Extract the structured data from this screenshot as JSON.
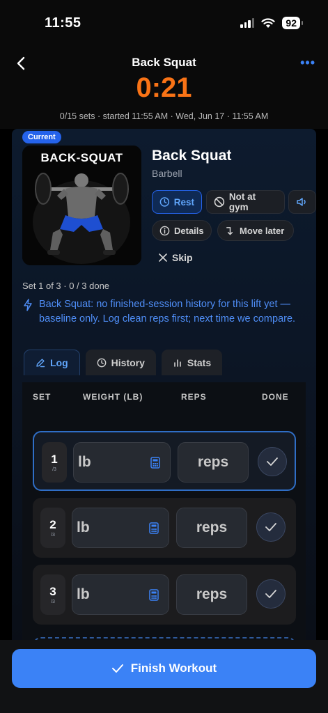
{
  "status": {
    "time": "11:55",
    "battery": "92"
  },
  "nav": {
    "title": "Back Squat",
    "more_icon": "ellipsis-icon"
  },
  "workout": {
    "timer": "0:21",
    "meta": "0/15 sets · started 11:55 AM · Wed, Jun 17 · 11:55 AM"
  },
  "exercise": {
    "badge": "Current",
    "image_title": "BACK-SQUAT",
    "name": "Back Squat",
    "equipment": "Barbell",
    "actions": {
      "rest": "Rest",
      "not_at_gym": "Not at gym",
      "details": "Details",
      "move_later": "Move later",
      "skip": "Skip"
    },
    "set_progress": "Set 1 of 3 · 0 / 3 done",
    "insight": "Back Squat: no finished-session history for this lift yet — baseline only. Log clean reps first; next time we compare."
  },
  "tabs": [
    {
      "label": "Log",
      "icon": "pencil-icon",
      "active": true
    },
    {
      "label": "History",
      "icon": "clock-icon",
      "active": false
    },
    {
      "label": "Stats",
      "icon": "bar-chart-icon",
      "active": false
    }
  ],
  "log": {
    "headers": {
      "set": "SET",
      "weight": "WEIGHT (LB)",
      "reps": "REPS",
      "done": "DONE"
    },
    "rows": [
      {
        "num": "1",
        "of": "/3",
        "weight_placeholder": "lb",
        "reps_placeholder": "reps",
        "active": true
      },
      {
        "num": "2",
        "of": "/3",
        "weight_placeholder": "lb",
        "reps_placeholder": "reps",
        "active": false
      },
      {
        "num": "3",
        "of": "/3",
        "weight_placeholder": "lb",
        "reps_placeholder": "reps",
        "active": false
      }
    ]
  },
  "footer": {
    "finish_label": "Finish Workout"
  },
  "colors": {
    "accent": "#3b82f6",
    "timer": "#f97316"
  }
}
